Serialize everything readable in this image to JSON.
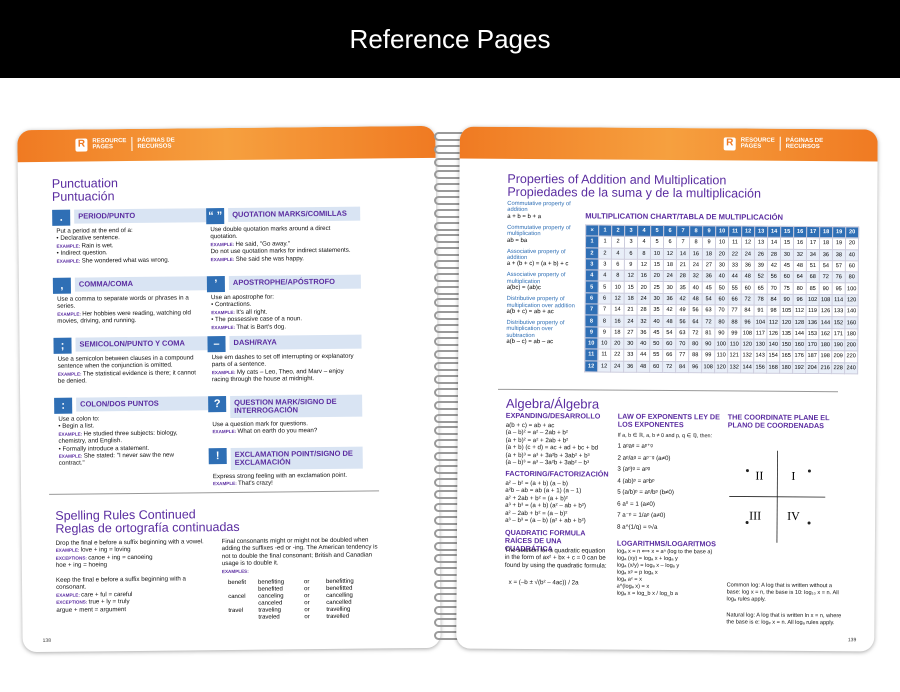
{
  "header": {
    "title": "Reference Pages"
  },
  "band": {
    "label_en": "RESOURCE PAGES",
    "label_es": "PÁGINAS DE RECURSOS",
    "logo": "R"
  },
  "left": {
    "punct_title": "Punctuation",
    "punct_title_es": "Puntuación",
    "sections": [
      {
        "icon": ".",
        "title": "PERIOD/PUNTO",
        "body": "Put a period at the end of a:\n• Declarative sentence.\nEXAMPLE: Rain is wet.\n• Indirect question.\nEXAMPLE: She wondered what was wrong."
      },
      {
        "icon": ",",
        "title": "COMMA/COMA",
        "body": "Use a comma to separate words or phrases in a series.\nEXAMPLE: Her hobbies were reading, watching old movies, driving, and running."
      },
      {
        "icon": ";",
        "title": "SEMICOLON/PUNTO Y COMA",
        "body": "Use a semicolon between clauses in a compound sentence when the conjunction is omitted.\nEXAMPLE: The statistical evidence is there; it cannot be denied."
      },
      {
        "icon": ":",
        "title": "COLON/DOS PUNTOS",
        "body": "Use a colon to:\n• Begin a list.\nEXAMPLE: He studied three subjects: biology, chemistry, and English.\n• Formally introduce a statement.\nEXAMPLE: She stated: \"I never saw the new contract.\""
      },
      {
        "icon": "“ ”",
        "title": "QUOTATION MARKS/COMILLAS",
        "body": "Use double quotation marks around a direct quotation.\nEXAMPLE: He said, \"Go away.\"\nDo not use quotation marks for indirect statements.\nEXAMPLE: She said she was happy."
      },
      {
        "icon": "’",
        "title": "APOSTROPHE/APÓSTROFO",
        "body": "Use an apostrophe for:\n• Contractions.\nEXAMPLE: It's all right.\n• The possessive case of a noun.\nEXAMPLE: That is Bart's dog."
      },
      {
        "icon": "–",
        "title": "DASH/RAYA",
        "body": "Use em dashes to set off interrupting or explanatory parts of a sentence.\nEXAMPLE: My cats – Leo, Theo, and Marv – enjoy racing through the house at midnight."
      },
      {
        "icon": "?",
        "title": "QUESTION MARK/SIGNO DE INTERROGACIÓN",
        "body": "Use a question mark for questions.\nEXAMPLE: What on earth do you mean?"
      },
      {
        "icon": "!",
        "title": "EXCLAMATION POINT/SIGNO DE EXCLAMACIÓN",
        "body": "Express strong feeling with an exclamation point.\nEXAMPLE: That's crazy!"
      }
    ],
    "spell_title": "Spelling Rules Continued",
    "spell_title_es": "Reglas de ortografía continuadas",
    "spell_col1": "Drop the final e before a suffix beginning with a vowel.\nEXAMPLE: love + ing = loving\nEXCEPTIONS: canoe + ing = canoeing\nhoe + ing = hoeing\n\nKeep the final e before a suffix beginning with a consonant.\nEXAMPLE: care + ful = careful\nEXCEPTIONS: true + ly = truly\nargue + ment = argument",
    "spell_col2": "Final consonants might or might not be doubled when adding the suffixes -ed or -ing. The American tendency is not to double the final consonant; British and Canadian usage is to double it.\nEXAMPLES:",
    "spell_rows": [
      [
        "benefit",
        "benefiting",
        "or",
        "benefitting"
      ],
      [
        "",
        "benefited",
        "or",
        "benefitted"
      ],
      [
        "cancel",
        "canceling",
        "or",
        "cancelling"
      ],
      [
        "",
        "canceled",
        "or",
        "cancelled"
      ],
      [
        "travel",
        "traveling",
        "or",
        "travelling"
      ],
      [
        "",
        "traveled",
        "or",
        "travelled"
      ]
    ],
    "page_num": "138"
  },
  "right": {
    "props_title": "Properties of Addition and Multiplication",
    "props_title_es": "Propiedades de la suma y de la multiplicación",
    "props": [
      [
        "Commutative property of addition",
        "a + b = b + a"
      ],
      [
        "Commutative property of multiplication",
        "ab = ba"
      ],
      [
        "Associative property of addition",
        "a + (b + c) = (a + b) + c"
      ],
      [
        "Associative property of multiplication",
        "a(bc) = (ab)c"
      ],
      [
        "Distributive property of multiplication over addition",
        "a(b + c) = ab + ac"
      ],
      [
        "Distributive property of multiplication over subtraction",
        "a(b – c) = ab – ac"
      ]
    ],
    "mult_title": "MULTIPLICATION CHART/TABLA DE MULTIPLICACIÓN",
    "mult_size": 20,
    "mult_rows": 12,
    "alg_title": "Algebra/Álgebra",
    "exp_title": "EXPANDING/DESARROLLO",
    "exp_lines": [
      "a(b + c) = ab + ac",
      "(a – b)² = a² – 2ab + b²",
      "(a + b)² = a² + 2ab + b²",
      "(a + b) (c + d) = ac + ad + bc + bd",
      "(a + b)³ = a³ + 3a²b + 3ab² + b³",
      "(a – b)³ = a³ – 3a²b + 3ab² – b³"
    ],
    "fact_title": "FACTORING/FACTORIZACIÓN",
    "fact_lines": [
      "a² – b² = (a + b) (a – b)",
      "a²b – ab = ab (a + 1) (a – 1)",
      "a² + 2ab + b² = (a + b)²",
      "a³ + b³ = (a + b) (a² – ab + b²)",
      "a² – 2ab + b² = (a – b)²",
      "a³ – b³ = (a – b) (a² + ab + b²)"
    ],
    "quad_title": "QUADRATIC FORMULA RAÍCES DE UNA CUADRÁTICA",
    "quad_text": "The solution for a quadratic equation in the form of ax² + bx + c = 0 can be found by using the quadratic formula:",
    "quad_formula": "x = (–b ± √(b² – 4ac)) / 2a",
    "law_title": "LAW OF EXPONENTS LEY DE LOS EXPONENTES",
    "law_intro": "If a, b ∈ ℝ, a, b ≠ 0 and p, q ∈ ℚ, then:",
    "law_lines": [
      "1  aᵖaᵍ = aᵖ⁺ᵍ",
      "2  aᵖ/aᵍ = aᵖ⁻ᵍ (a≠0)",
      "3  (aᵖ)ᵍ = aᵖᵍ",
      "4  (ab)ᵖ = aᵖbᵖ",
      "5  (a/b)ᵖ = aᵖ/bᵖ (b≠0)",
      "6  a⁰ = 1 (a≠0)",
      "7  a⁻ᵖ = 1/aᵖ (a≠0)",
      "8  a^(1/q) = ᵍ√a"
    ],
    "log_title": "LOGARITHMS/LOGARITMOS",
    "log_lines": [
      "logₐ x = n ⟺ x = aⁿ (log to the base a)",
      "logₐ (xy) = logₐ x + logₐ y",
      "logₐ (x/y) = logₐ x – logₐ y",
      "logₐ xᵖ = p logₐ x",
      "logₐ aˣ = x",
      "a^(logₐ x) = x",
      "logₐ x = log_b x / log_b a"
    ],
    "plane_title": "THE COORDINATE PLANE EL PLANO DE COORDENADAS",
    "quadrants": [
      "II",
      "I",
      "III",
      "IV"
    ],
    "common_log": "Common log: A log that is written without a base: log x = n, the base is 10: log₁₀ x = n. All logₐ rules apply.",
    "natural_log": "Natural log: A log that is written ln x = n, where the base is e: logₑ x = n. All logₐ rules apply.",
    "page_num": "139"
  }
}
